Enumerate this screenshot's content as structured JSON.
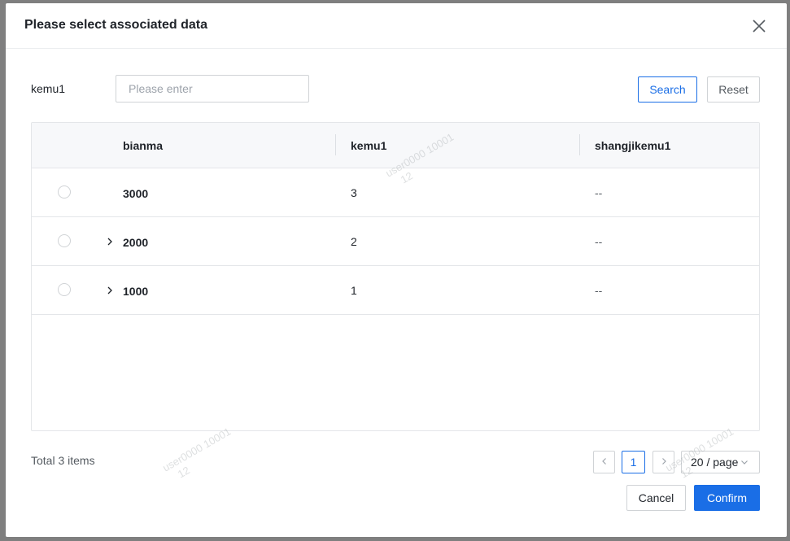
{
  "dialog": {
    "title": "Please select associated data"
  },
  "filter": {
    "label": "kemu1",
    "placeholder": "Please enter",
    "value": "",
    "search_label": "Search",
    "reset_label": "Reset"
  },
  "table": {
    "columns": [
      "bianma",
      "kemu1",
      "shangjikemu1"
    ],
    "rows": [
      {
        "bianma": "3000",
        "kemu1": "3",
        "shangjikemu1": "--",
        "expandable": false
      },
      {
        "bianma": "2000",
        "kemu1": "2",
        "shangjikemu1": "--",
        "expandable": true
      },
      {
        "bianma": "1000",
        "kemu1": "1",
        "shangjikemu1": "--",
        "expandable": true
      }
    ]
  },
  "pagination": {
    "total_text": "Total 3 items",
    "current_page": "1",
    "page_size": "20 / page"
  },
  "footer": {
    "cancel_label": "Cancel",
    "confirm_label": "Confirm"
  },
  "watermark": {
    "line1": "user0000 10001",
    "line2": "12"
  },
  "colors": {
    "primary": "#1a6ee6",
    "border": "#d0d3d6",
    "header_bg": "#f7f8fa",
    "overlay": "#7f7f7f"
  }
}
